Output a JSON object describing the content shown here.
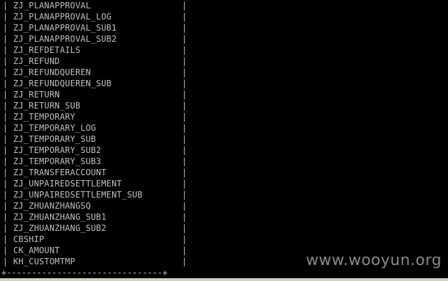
{
  "table": {
    "rows": [
      "ZJ_PLANAPPROVAL",
      "ZJ_PLANAPPROVAL_LOG",
      "ZJ_PLANAPPROVAL_SUB1",
      "ZJ_PLANAPPROVAL_SUB2",
      "ZJ_REFDETAILS",
      "ZJ_REFUND",
      "ZJ_REFUNDQUEREN",
      "ZJ_REFUNDQUEREN_SUB",
      "ZJ_RETURN",
      "ZJ_RETURN_SUB",
      "ZJ_TEMPORARY",
      "ZJ_TEMPORARY_LOG",
      "ZJ_TEMPORARY_SUB",
      "ZJ_TEMPORARY_SUB2",
      "ZJ_TEMPORARY_SUB3",
      "ZJ_TRANSFERACCOUNT",
      "ZJ_UNPAIREDSETTLEMENT",
      "ZJ_UNPAIREDSETTLEMENT_SUB",
      "ZJ_ZHUANZHANGSQ",
      "ZJ_ZHUANZHANG_SUB1",
      "ZJ_ZHUANZHANG_SUB2",
      "CBSHIP",
      "CK_AMOUNT",
      "KH_CUSTOMTMP"
    ],
    "border_char": "|",
    "bottom_border": "+-------------------------------+"
  },
  "watermark": "www.wooyun.org",
  "colors": {
    "background": "#000000",
    "text": "#c0c0c0",
    "watermark": "#8a8a8a"
  }
}
